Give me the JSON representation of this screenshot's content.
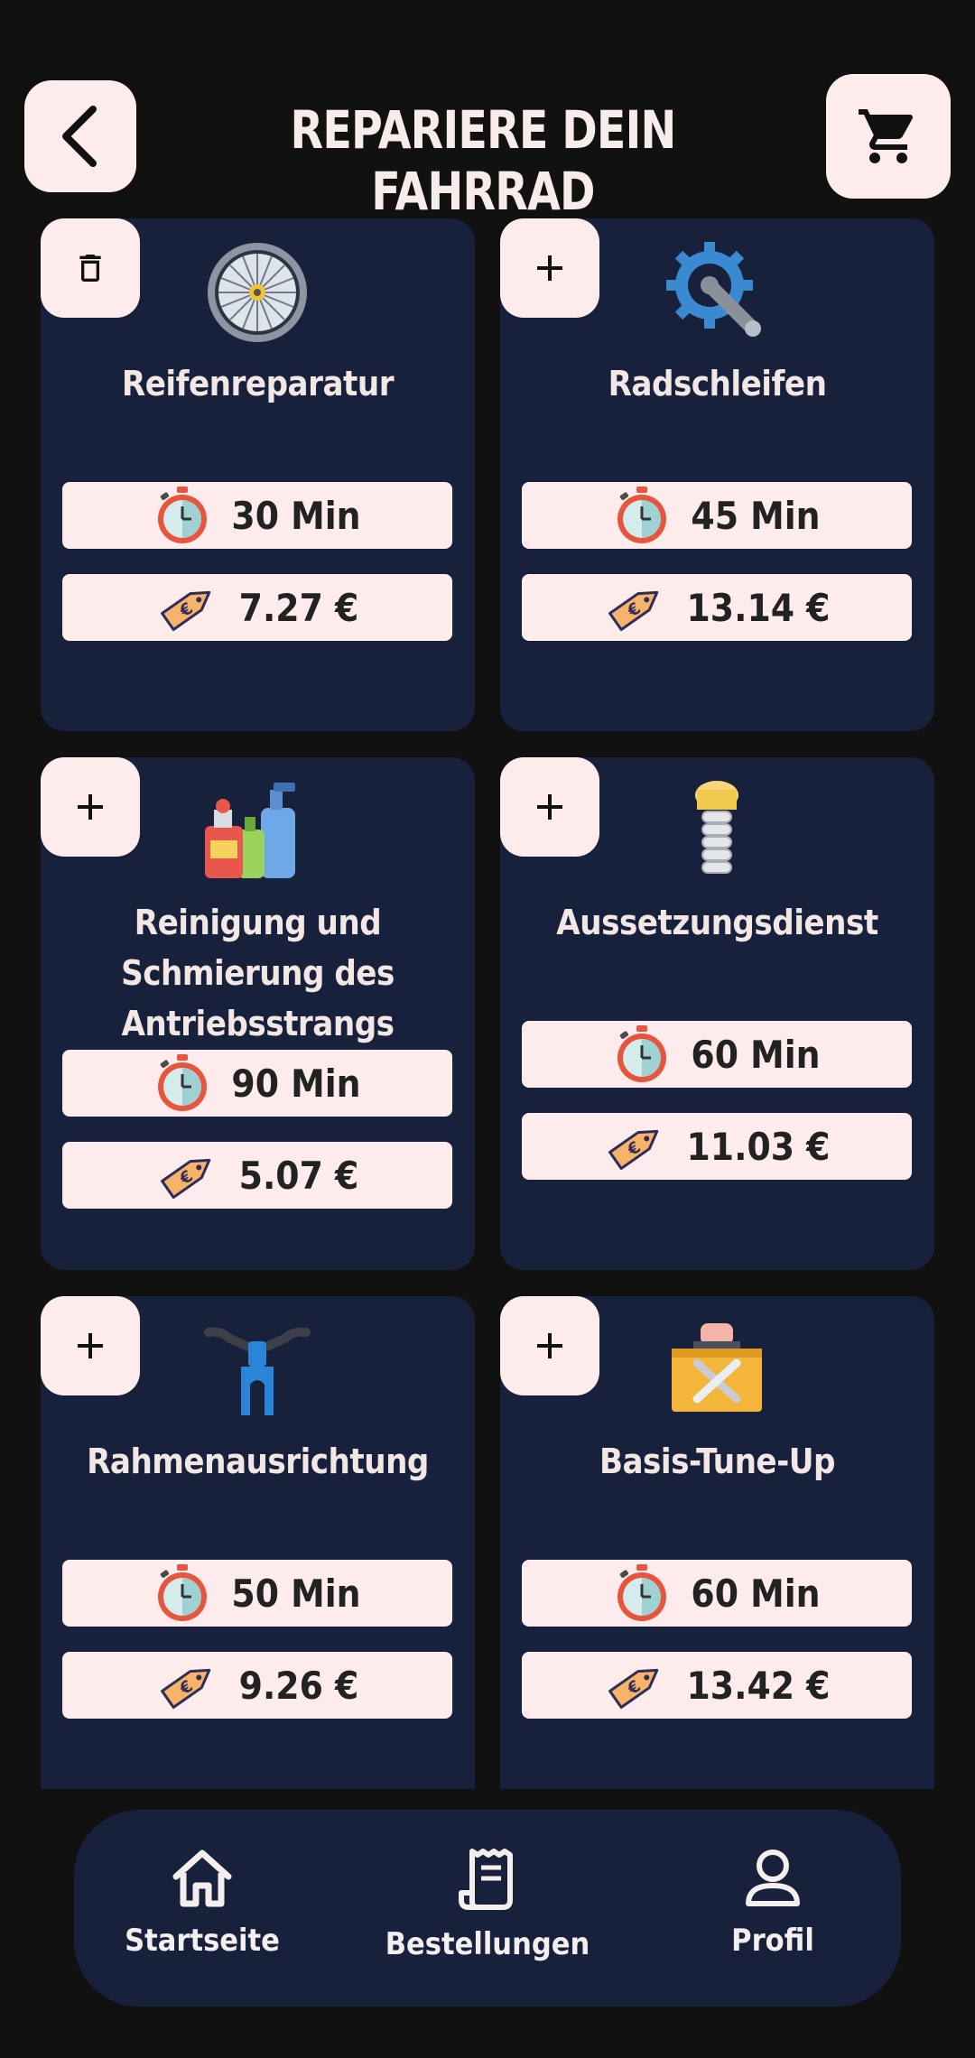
{
  "header": {
    "title": "REPARIERE DEIN FAHRRAD",
    "back_icon": "chevron-left-icon",
    "cart_icon": "cart-icon"
  },
  "services": [
    {
      "name": "Reifenreparatur",
      "time": "30 Min",
      "price": "7.27 €",
      "action": "delete",
      "icon": "wheel-icon"
    },
    {
      "name": "Radschleifen",
      "time": "45 Min",
      "price": "13.14 €",
      "action": "add",
      "icon": "crank-gear-icon"
    },
    {
      "name": "Reinigung und Schmierung des Antriebsstrangs",
      "time": "90 Min",
      "price": "5.07 €",
      "action": "add",
      "icon": "cleaning-bottles-icon"
    },
    {
      "name": "Aussetzungsdienst",
      "time": "60 Min",
      "price": "11.03 €",
      "action": "add",
      "icon": "suspension-spring-icon"
    },
    {
      "name": "Rahmenausrichtung",
      "time": "50 Min",
      "price": "9.26 €",
      "action": "add",
      "icon": "frame-fork-icon"
    },
    {
      "name": "Basis-Tune-Up",
      "time": "60 Min",
      "price": "13.42 €",
      "action": "add",
      "icon": "toolbox-icon"
    }
  ],
  "nav": [
    {
      "label": "Startseite",
      "icon": "home-icon"
    },
    {
      "label": "Bestellungen",
      "icon": "receipt-icon"
    },
    {
      "label": "Profil",
      "icon": "user-icon"
    }
  ],
  "colors": {
    "background": "#111111",
    "card": "#18213b",
    "pill": "#fdeceb",
    "text_light": "#f3e7e6"
  }
}
